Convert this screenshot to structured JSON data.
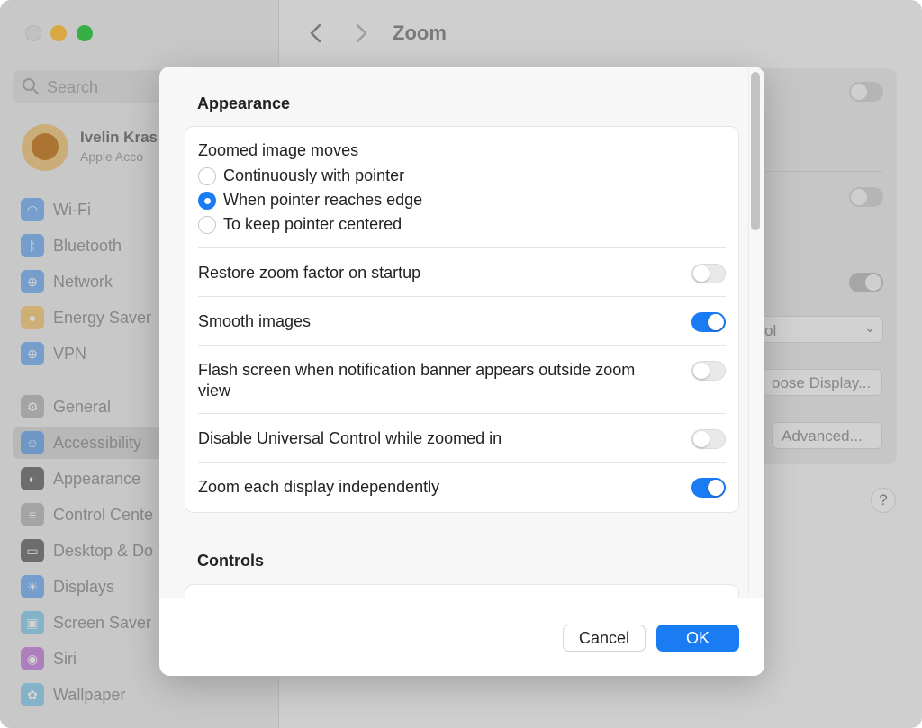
{
  "window": {
    "title": "Zoom",
    "nav": {
      "back_icon": "chevron-left-icon",
      "forward_icon": "chevron-right-icon"
    },
    "traffic_lights": {
      "close": "#dcdcdc",
      "minimize": "#f7c04a",
      "maximize": "#3ec94e"
    }
  },
  "sidebar": {
    "search_placeholder": "Search",
    "profile": {
      "name": "Ivelin Kras",
      "subtitle": "Apple Acco"
    },
    "items": [
      {
        "label": "Wi-Fi",
        "icon": "wifi-icon",
        "color": "#3c8ef0"
      },
      {
        "label": "Bluetooth",
        "icon": "bluetooth-icon",
        "color": "#3c8ef0"
      },
      {
        "label": "Network",
        "icon": "globe-icon",
        "color": "#3c8ef0"
      },
      {
        "label": "Energy Saver",
        "icon": "lightbulb-icon",
        "color": "#f2b33d"
      },
      {
        "label": "VPN",
        "icon": "globe-icon",
        "color": "#3c8ef0"
      },
      {
        "label": "General",
        "icon": "gear-icon",
        "color": "#9a9a9a"
      },
      {
        "label": "Accessibility",
        "icon": "accessibility-icon",
        "color": "#3c8ef0",
        "selected": true
      },
      {
        "label": "Appearance",
        "icon": "appearance-icon",
        "color": "#2a2a2a"
      },
      {
        "label": "Control Cente",
        "icon": "control-center-icon",
        "color": "#9a9a9a"
      },
      {
        "label": "Desktop & Do",
        "icon": "desktop-icon",
        "color": "#2a2a2a"
      },
      {
        "label": "Displays",
        "icon": "sun-icon",
        "color": "#3c8ef0"
      },
      {
        "label": "Screen Saver",
        "icon": "screen-saver-icon",
        "color": "#5ab8e6"
      },
      {
        "label": "Siri",
        "icon": "siri-icon",
        "color": "#b04fd0"
      },
      {
        "label": "Wallpaper",
        "icon": "flower-icon",
        "color": "#5ab8e6"
      }
    ]
  },
  "background_panel": {
    "select_value": "ol",
    "choose_display_label": "oose Display...",
    "advanced_label": "Advanced...",
    "help_label": "?"
  },
  "sheet": {
    "appearance": {
      "title": "Appearance",
      "zoomed_image_moves_label": "Zoomed image moves",
      "radio_options": [
        {
          "label": "Continuously with pointer",
          "checked": false
        },
        {
          "label": "When pointer reaches edge",
          "checked": true
        },
        {
          "label": "To keep pointer centered",
          "checked": false
        }
      ],
      "toggles": [
        {
          "label": "Restore zoom factor on startup",
          "on": false
        },
        {
          "label": "Smooth images",
          "on": true
        },
        {
          "label": "Flash screen when notification banner appears outside zoom view",
          "on": false
        },
        {
          "label": "Disable Universal Control while zoomed in",
          "on": false
        },
        {
          "label": "Zoom each display independently",
          "on": true
        }
      ]
    },
    "controls": {
      "title": "Controls"
    },
    "buttons": {
      "cancel": "Cancel",
      "ok": "OK"
    },
    "accent_color": "#1a7cf3"
  }
}
